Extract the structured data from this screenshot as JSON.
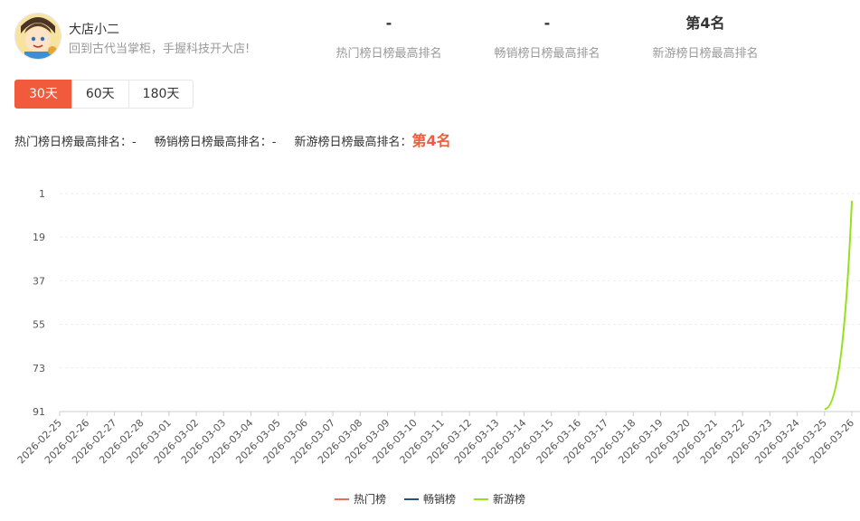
{
  "header": {
    "game_name": "大店小二",
    "game_desc": "回到古代当掌柜，手握科技开大店!",
    "stats": [
      {
        "value": "-",
        "label": "热门榜日榜最高排名"
      },
      {
        "value": "-",
        "label": "畅销榜日榜最高排名"
      },
      {
        "value": "第4名",
        "label": "新游榜日榜最高排名"
      }
    ]
  },
  "tabs": [
    {
      "label": "30天",
      "active": true
    },
    {
      "label": "60天",
      "active": false
    },
    {
      "label": "180天",
      "active": false
    }
  ],
  "summary": [
    {
      "label": "热门榜日榜最高排名：",
      "value": "-"
    },
    {
      "label": "畅销榜日榜最高排名：",
      "value": "-"
    },
    {
      "label": "新游榜日榜最高排名：",
      "value": "第4名"
    }
  ],
  "colors": {
    "accent": "#f15a3c",
    "hot": "#ee6a50",
    "bestseller": "#2c4f7c",
    "newgame": "#95e01f"
  },
  "chart_data": {
    "type": "line",
    "x": [
      "2026-02-25",
      "2026-02-26",
      "2026-02-27",
      "2026-02-28",
      "2026-03-01",
      "2026-03-02",
      "2026-03-03",
      "2026-03-04",
      "2026-03-05",
      "2026-03-06",
      "2026-03-07",
      "2026-03-08",
      "2026-03-09",
      "2026-03-10",
      "2026-03-11",
      "2026-03-12",
      "2026-03-13",
      "2026-03-14",
      "2026-03-15",
      "2026-03-16",
      "2026-03-17",
      "2026-03-18",
      "2026-03-19",
      "2026-03-20",
      "2026-03-21",
      "2026-03-22",
      "2026-03-23",
      "2026-03-24",
      "2026-03-25",
      "2026-03-26"
    ],
    "y_ticks": [
      1,
      19,
      37,
      55,
      73,
      91
    ],
    "ylim": [
      1,
      91
    ],
    "y_inverted": true,
    "grid": true,
    "legend_position": "bottom-center",
    "series": [
      {
        "name": "热门榜",
        "color": "#ee6a50",
        "values": [
          null,
          null,
          null,
          null,
          null,
          null,
          null,
          null,
          null,
          null,
          null,
          null,
          null,
          null,
          null,
          null,
          null,
          null,
          null,
          null,
          null,
          null,
          null,
          null,
          null,
          null,
          null,
          null,
          null,
          null
        ]
      },
      {
        "name": "畅销榜",
        "color": "#2c4f7c",
        "values": [
          null,
          null,
          null,
          null,
          null,
          null,
          null,
          null,
          null,
          null,
          null,
          null,
          null,
          null,
          null,
          null,
          null,
          null,
          null,
          null,
          null,
          null,
          null,
          null,
          null,
          null,
          null,
          null,
          null,
          null
        ]
      },
      {
        "name": "新游榜",
        "color": "#95e01f",
        "values": [
          null,
          null,
          null,
          null,
          null,
          null,
          null,
          null,
          null,
          null,
          null,
          null,
          null,
          null,
          null,
          null,
          null,
          null,
          null,
          null,
          null,
          null,
          null,
          null,
          null,
          null,
          null,
          null,
          90,
          4
        ]
      }
    ]
  }
}
